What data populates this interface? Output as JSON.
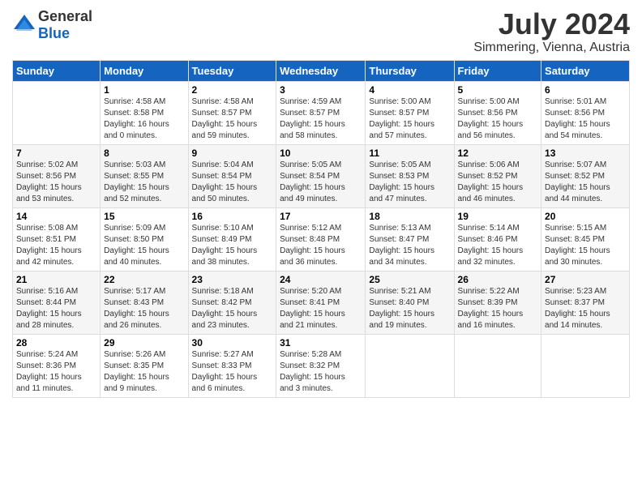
{
  "header": {
    "logo_general": "General",
    "logo_blue": "Blue",
    "title": "July 2024",
    "subtitle": "Simmering, Vienna, Austria"
  },
  "days_of_week": [
    "Sunday",
    "Monday",
    "Tuesday",
    "Wednesday",
    "Thursday",
    "Friday",
    "Saturday"
  ],
  "weeks": [
    [
      {
        "day": "",
        "info": ""
      },
      {
        "day": "1",
        "info": "Sunrise: 4:58 AM\nSunset: 8:58 PM\nDaylight: 16 hours\nand 0 minutes."
      },
      {
        "day": "2",
        "info": "Sunrise: 4:58 AM\nSunset: 8:57 PM\nDaylight: 15 hours\nand 59 minutes."
      },
      {
        "day": "3",
        "info": "Sunrise: 4:59 AM\nSunset: 8:57 PM\nDaylight: 15 hours\nand 58 minutes."
      },
      {
        "day": "4",
        "info": "Sunrise: 5:00 AM\nSunset: 8:57 PM\nDaylight: 15 hours\nand 57 minutes."
      },
      {
        "day": "5",
        "info": "Sunrise: 5:00 AM\nSunset: 8:56 PM\nDaylight: 15 hours\nand 56 minutes."
      },
      {
        "day": "6",
        "info": "Sunrise: 5:01 AM\nSunset: 8:56 PM\nDaylight: 15 hours\nand 54 minutes."
      }
    ],
    [
      {
        "day": "7",
        "info": "Sunrise: 5:02 AM\nSunset: 8:56 PM\nDaylight: 15 hours\nand 53 minutes."
      },
      {
        "day": "8",
        "info": "Sunrise: 5:03 AM\nSunset: 8:55 PM\nDaylight: 15 hours\nand 52 minutes."
      },
      {
        "day": "9",
        "info": "Sunrise: 5:04 AM\nSunset: 8:54 PM\nDaylight: 15 hours\nand 50 minutes."
      },
      {
        "day": "10",
        "info": "Sunrise: 5:05 AM\nSunset: 8:54 PM\nDaylight: 15 hours\nand 49 minutes."
      },
      {
        "day": "11",
        "info": "Sunrise: 5:05 AM\nSunset: 8:53 PM\nDaylight: 15 hours\nand 47 minutes."
      },
      {
        "day": "12",
        "info": "Sunrise: 5:06 AM\nSunset: 8:52 PM\nDaylight: 15 hours\nand 46 minutes."
      },
      {
        "day": "13",
        "info": "Sunrise: 5:07 AM\nSunset: 8:52 PM\nDaylight: 15 hours\nand 44 minutes."
      }
    ],
    [
      {
        "day": "14",
        "info": "Sunrise: 5:08 AM\nSunset: 8:51 PM\nDaylight: 15 hours\nand 42 minutes."
      },
      {
        "day": "15",
        "info": "Sunrise: 5:09 AM\nSunset: 8:50 PM\nDaylight: 15 hours\nand 40 minutes."
      },
      {
        "day": "16",
        "info": "Sunrise: 5:10 AM\nSunset: 8:49 PM\nDaylight: 15 hours\nand 38 minutes."
      },
      {
        "day": "17",
        "info": "Sunrise: 5:12 AM\nSunset: 8:48 PM\nDaylight: 15 hours\nand 36 minutes."
      },
      {
        "day": "18",
        "info": "Sunrise: 5:13 AM\nSunset: 8:47 PM\nDaylight: 15 hours\nand 34 minutes."
      },
      {
        "day": "19",
        "info": "Sunrise: 5:14 AM\nSunset: 8:46 PM\nDaylight: 15 hours\nand 32 minutes."
      },
      {
        "day": "20",
        "info": "Sunrise: 5:15 AM\nSunset: 8:45 PM\nDaylight: 15 hours\nand 30 minutes."
      }
    ],
    [
      {
        "day": "21",
        "info": "Sunrise: 5:16 AM\nSunset: 8:44 PM\nDaylight: 15 hours\nand 28 minutes."
      },
      {
        "day": "22",
        "info": "Sunrise: 5:17 AM\nSunset: 8:43 PM\nDaylight: 15 hours\nand 26 minutes."
      },
      {
        "day": "23",
        "info": "Sunrise: 5:18 AM\nSunset: 8:42 PM\nDaylight: 15 hours\nand 23 minutes."
      },
      {
        "day": "24",
        "info": "Sunrise: 5:20 AM\nSunset: 8:41 PM\nDaylight: 15 hours\nand 21 minutes."
      },
      {
        "day": "25",
        "info": "Sunrise: 5:21 AM\nSunset: 8:40 PM\nDaylight: 15 hours\nand 19 minutes."
      },
      {
        "day": "26",
        "info": "Sunrise: 5:22 AM\nSunset: 8:39 PM\nDaylight: 15 hours\nand 16 minutes."
      },
      {
        "day": "27",
        "info": "Sunrise: 5:23 AM\nSunset: 8:37 PM\nDaylight: 15 hours\nand 14 minutes."
      }
    ],
    [
      {
        "day": "28",
        "info": "Sunrise: 5:24 AM\nSunset: 8:36 PM\nDaylight: 15 hours\nand 11 minutes."
      },
      {
        "day": "29",
        "info": "Sunrise: 5:26 AM\nSunset: 8:35 PM\nDaylight: 15 hours\nand 9 minutes."
      },
      {
        "day": "30",
        "info": "Sunrise: 5:27 AM\nSunset: 8:33 PM\nDaylight: 15 hours\nand 6 minutes."
      },
      {
        "day": "31",
        "info": "Sunrise: 5:28 AM\nSunset: 8:32 PM\nDaylight: 15 hours\nand 3 minutes."
      },
      {
        "day": "",
        "info": ""
      },
      {
        "day": "",
        "info": ""
      },
      {
        "day": "",
        "info": ""
      }
    ]
  ]
}
